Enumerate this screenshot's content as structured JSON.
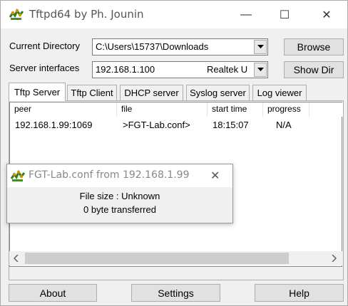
{
  "window": {
    "title": "Tftpd64 by Ph. Jounin",
    "controls": {
      "minimize": "—",
      "maximize": "☐",
      "close": "✕"
    }
  },
  "form": {
    "current_directory_label": "Current Directory",
    "current_directory_value": "C:\\Users\\15737\\Downloads",
    "server_interfaces_label": "Server interfaces",
    "server_interface_ip": "192.168.1.100",
    "server_interface_adapter": "Realtek U",
    "browse_label": "Browse",
    "show_dir_label": "Show Dir"
  },
  "tabs": [
    {
      "label": "Tftp Server",
      "active": true
    },
    {
      "label": "Tftp Client"
    },
    {
      "label": "DHCP server"
    },
    {
      "label": "Syslog server"
    },
    {
      "label": "Log viewer"
    }
  ],
  "table": {
    "columns": [
      "peer",
      "file",
      "start time",
      "progress"
    ],
    "rows": [
      [
        "192.168.1.99:1069",
        ">FGT-Lab.conf>",
        "18:15:07",
        "N/A"
      ]
    ]
  },
  "popup": {
    "title": "FGT-Lab.conf from 192.168.1.99",
    "file_size": "File size : Unknown",
    "transferred": "0 byte transferred",
    "close": "✕"
  },
  "footer": {
    "about_label": "About",
    "settings_label": "Settings",
    "help_label": "Help"
  },
  "icons": {
    "app": "tftpd-app-icon",
    "dropdown": "chevron-down-icon",
    "scroll_left": "chevron-left-icon",
    "scroll_right": "chevron-right-icon"
  },
  "colors": {
    "window_bg": "#f0f0f0",
    "button_bg": "#e1e1e1",
    "title_text": "#555555"
  }
}
